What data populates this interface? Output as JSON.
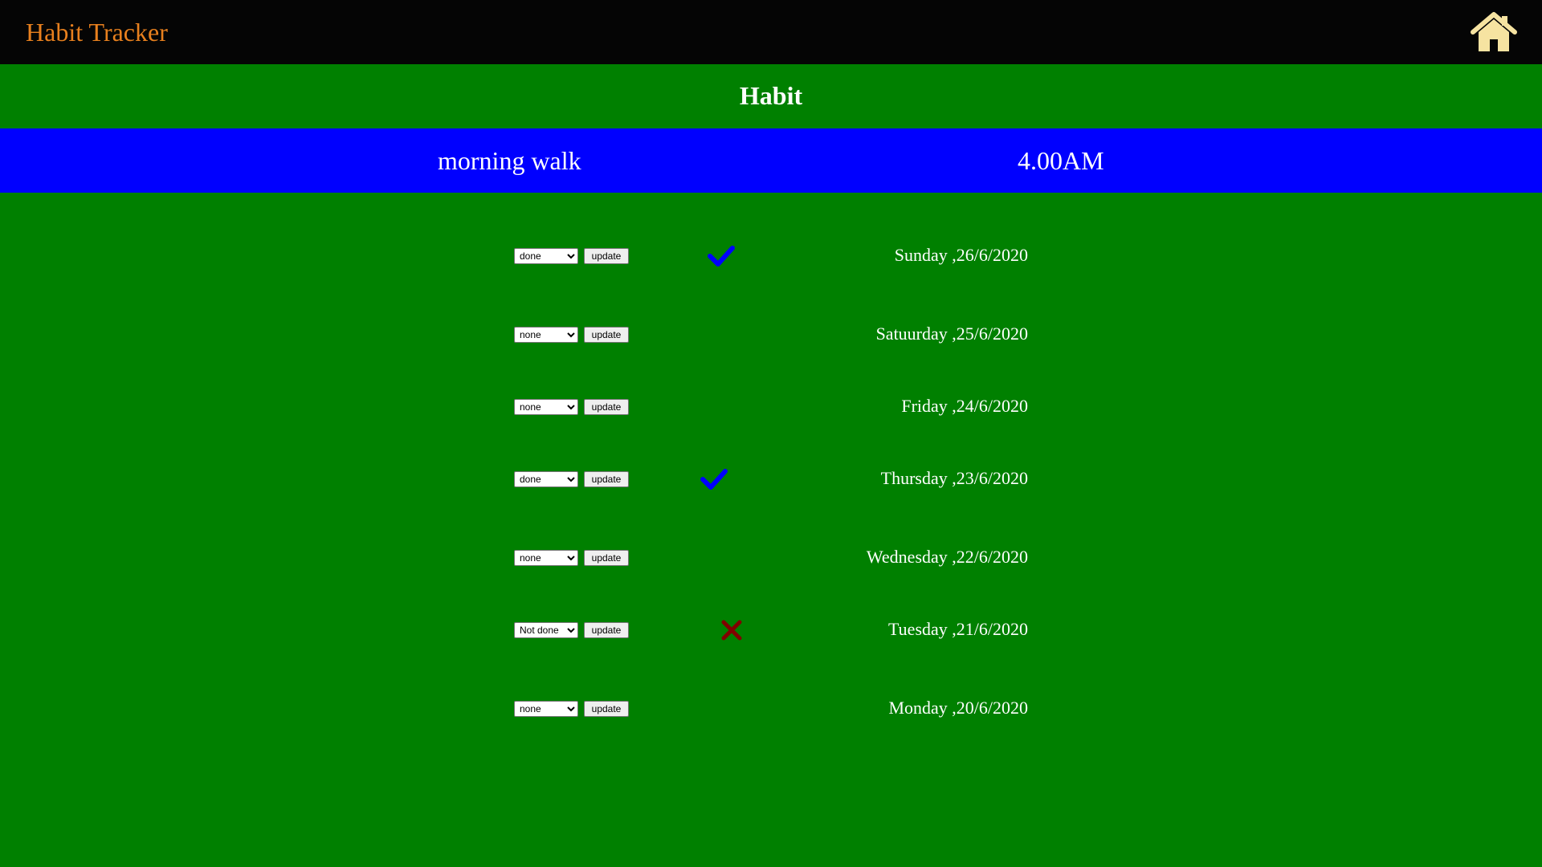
{
  "app": {
    "title": "Habit Tracker",
    "home_icon": "home-icon"
  },
  "colors": {
    "topbar_bg": "#050505",
    "brand": "#e8801e",
    "page_bg": "#008000",
    "habit_bar_bg": "#0000ff",
    "home_icon": "#f6e3a1",
    "done_mark": "#0000ff",
    "not_done_mark": "#800000"
  },
  "header": {
    "title": "Habit"
  },
  "habit": {
    "name": "morning walk",
    "time": "4.00AM"
  },
  "status_options": [
    "none",
    "done",
    "Not done"
  ],
  "days": [
    {
      "status": "done",
      "date": "Sunday ,26/6/2020",
      "button": "update",
      "mark": "check-icon"
    },
    {
      "status": "none",
      "date": "Satuurday ,25/6/2020",
      "button": "update",
      "mark": ""
    },
    {
      "status": "none",
      "date": "Friday ,24/6/2020",
      "button": "update",
      "mark": ""
    },
    {
      "status": "done",
      "date": "Thursday ,23/6/2020",
      "button": "update",
      "mark": "check-icon"
    },
    {
      "status": "none",
      "date": "Wednesday ,22/6/2020",
      "button": "update",
      "mark": ""
    },
    {
      "status": "Not done",
      "date": "Tuesday ,21/6/2020",
      "button": "update",
      "mark": "cross-icon"
    },
    {
      "status": "none",
      "date": "Monday ,20/6/2020",
      "button": "update",
      "mark": ""
    }
  ]
}
